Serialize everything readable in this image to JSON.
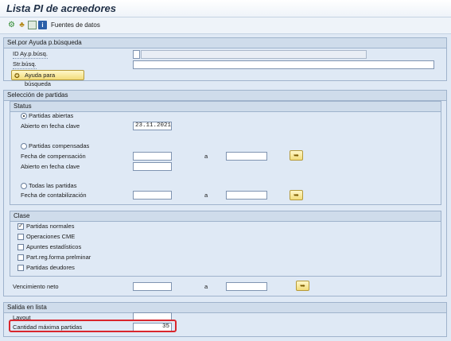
{
  "window": {
    "title": "Lista PI de acreedores"
  },
  "toolbar": {
    "execute_icon": "execute-icon",
    "variant_icon": "get-variant-icon",
    "save_icon": "save-variant-icon",
    "info_icon": "info-icon",
    "data_sources_label": "Fuentes de datos"
  },
  "search_help": {
    "title": "Sel.por Ayuda p.búsqueda",
    "id_label": "ID Ay.p.búsq.",
    "id_value": "",
    "str_label": "Str.búsq.",
    "str_value": "",
    "button_label": "Ayuda para búsqueda"
  },
  "selection": {
    "title": "Selección de partidas",
    "status": {
      "title": "Status",
      "open_label": "Partidas abiertas",
      "open_key_date_label": "Abierto en fecha clave",
      "open_key_date_value": "23.11.2021",
      "cleared_label": "Partidas compensadas",
      "clearing_date_label": "Fecha de compensación",
      "to_label": "a",
      "cleared_key_date_label": "Abierto en fecha clave",
      "all_label": "Todas las partidas",
      "posting_date_label": "Fecha de contabilización",
      "to_label_2": "a",
      "selected": "open"
    },
    "type": {
      "title": "Clase",
      "items": [
        {
          "label": "Partidas normales",
          "checked": true
        },
        {
          "label": "Operaciones CME",
          "checked": false
        },
        {
          "label": "Apuntes estadísticos",
          "checked": false
        },
        {
          "label": "Part.reg.forma prelminar",
          "checked": false
        },
        {
          "label": "Partidas deudores",
          "checked": false
        }
      ]
    },
    "net_due_label": "Vencimiento neto",
    "net_due_to_label": "a"
  },
  "output": {
    "title": "Salida en lista",
    "layout_label": "Layout",
    "layout_value": "",
    "max_items_label": "Cantidad máxima partidas",
    "max_items_value": "35"
  }
}
